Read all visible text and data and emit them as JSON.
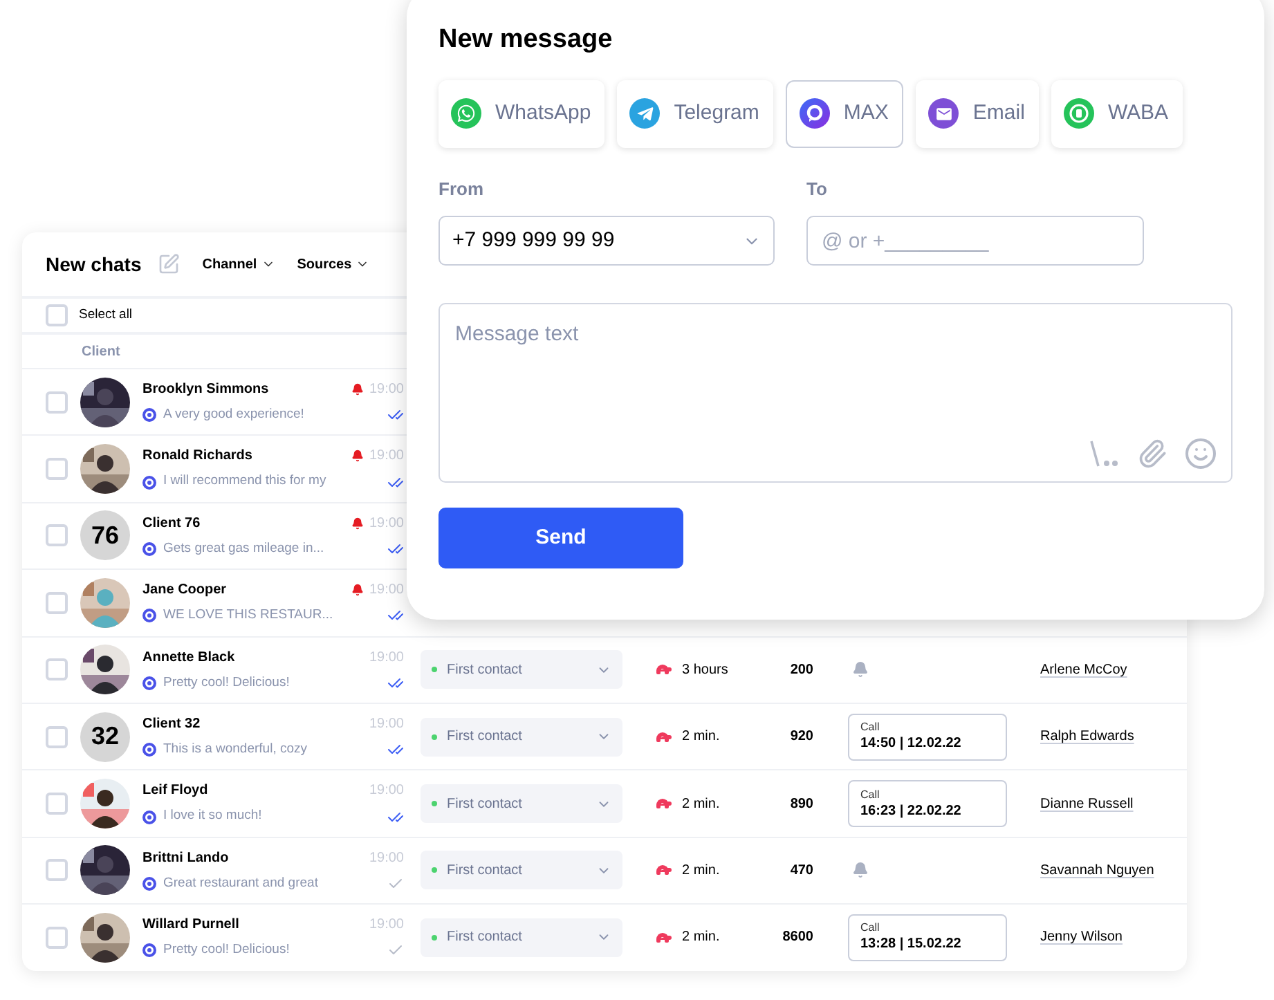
{
  "chats": {
    "title": "New chats",
    "filters": [
      {
        "label": "Channel"
      },
      {
        "label": "Sources"
      }
    ],
    "select_all": {
      "label": "Select all",
      "checked": false
    },
    "column_client": "Client",
    "rows": [
      {
        "name": "Brooklyn Simmons",
        "time": "19:00",
        "alert": true,
        "preview": "A very good experience!",
        "read": true,
        "checked": false
      },
      {
        "name": "Ronald Richards",
        "time": "19:00",
        "alert": true,
        "preview": "I will recommend this for my",
        "read": true,
        "checked": false
      },
      {
        "name": "Client 76",
        "avatar": {
          "kind": "number",
          "text": "76"
        },
        "time": "19:00",
        "alert": true,
        "preview": "Gets great gas mileage in...",
        "read": true,
        "checked": false
      },
      {
        "name": "Jane Cooper",
        "time": "19:00",
        "alert": true,
        "preview": "WE LOVE THIS RESTAUR...",
        "read": true,
        "checked": false
      },
      {
        "name": "Annette Black",
        "time": "19:00",
        "alert": false,
        "preview": "Pretty cool! Delicious!",
        "read": true,
        "checked": false,
        "stage": "First contact",
        "wait": "3 hours",
        "count": "200",
        "reminder": {
          "kind": "bell"
        },
        "manager": "Arlene McCoy"
      },
      {
        "name": "Client 32",
        "avatar": {
          "kind": "number",
          "text": "32"
        },
        "time": "19:00",
        "alert": false,
        "preview": "This is a wonderful, cozy",
        "read": true,
        "checked": false,
        "stage": "First contact",
        "wait": "2 min.",
        "count": "920",
        "reminder": {
          "kind": "call",
          "label": "Call",
          "when": "14:50 | 12.02.22"
        },
        "manager": "Ralph Edwards"
      },
      {
        "name": "Leif Floyd",
        "time": "19:00",
        "alert": false,
        "preview": "I love it so much!",
        "read": true,
        "checked": false,
        "stage": "First contact",
        "wait": "2 min.",
        "count": "890",
        "reminder": {
          "kind": "call",
          "label": "Call",
          "when": "16:23 | 22.02.22"
        },
        "manager": "Dianne Russell"
      },
      {
        "name": "Brittni Lando",
        "time": "19:00",
        "alert": false,
        "preview": "Great restaurant and great",
        "read": false,
        "checked": false,
        "stage": "First contact",
        "wait": "2 min.",
        "count": "470",
        "reminder": {
          "kind": "bell"
        },
        "manager": "Savannah Nguyen"
      },
      {
        "name": "Willard Purnell",
        "time": "19:00",
        "alert": false,
        "preview": "Pretty cool! Delicious!",
        "read": false,
        "checked": false,
        "stage": "First contact",
        "wait": "2 min.",
        "count": "8600",
        "reminder": {
          "kind": "call",
          "label": "Call",
          "when": "13:28 | 15.02.22"
        },
        "manager": "Jenny Wilson"
      }
    ]
  },
  "message": {
    "title": "New message",
    "channels": [
      {
        "label": "WhatsApp",
        "kind": "whatsapp",
        "selected": false
      },
      {
        "label": "Telegram",
        "kind": "telegram",
        "selected": false
      },
      {
        "label": "MAX",
        "kind": "max",
        "selected": true
      },
      {
        "label": "Email",
        "kind": "email",
        "selected": false
      },
      {
        "label": "WABA",
        "kind": "waba",
        "selected": false
      }
    ],
    "from": {
      "label": "From",
      "value": "+7 999 999 99 99"
    },
    "to": {
      "label": "To",
      "placeholder": "@ or +_________"
    },
    "text": {
      "placeholder": "Message text"
    },
    "send": "Send"
  }
}
